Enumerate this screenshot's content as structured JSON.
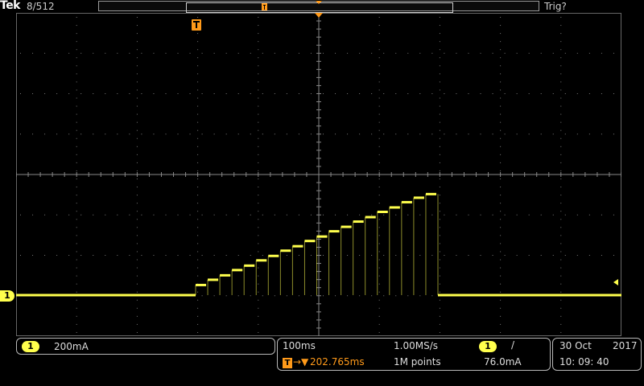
{
  "header": {
    "brand": "Tek",
    "acquisition_count": "8/512",
    "trigger_status": "Trig?"
  },
  "channel": {
    "marker_label": "1",
    "scale": "200mA",
    "color": "#ffff4d"
  },
  "timebase": {
    "scale": "100ms",
    "sample_rate": "1.00MS/s",
    "record_length": "1M points",
    "trigger_marker": "T",
    "trigger_position_arrow": "→▼",
    "trigger_position": "202.765ms"
  },
  "trigger": {
    "source": "1",
    "slope_symbol": "/",
    "level": "76.0mA",
    "color": "#ff9a1a"
  },
  "datetime": {
    "date_day_month": "30 Oct",
    "year": "2017",
    "time": "10: 09: 40"
  },
  "waveform": {
    "baseline_level": 0,
    "step_count": 20,
    "step_levels_divisions": [
      0.25,
      0.38,
      0.49,
      0.62,
      0.73,
      0.86,
      0.97,
      1.1,
      1.21,
      1.34,
      1.45,
      1.58,
      1.69,
      1.82,
      1.93,
      2.06,
      2.17,
      2.3,
      2.41,
      2.5
    ]
  }
}
